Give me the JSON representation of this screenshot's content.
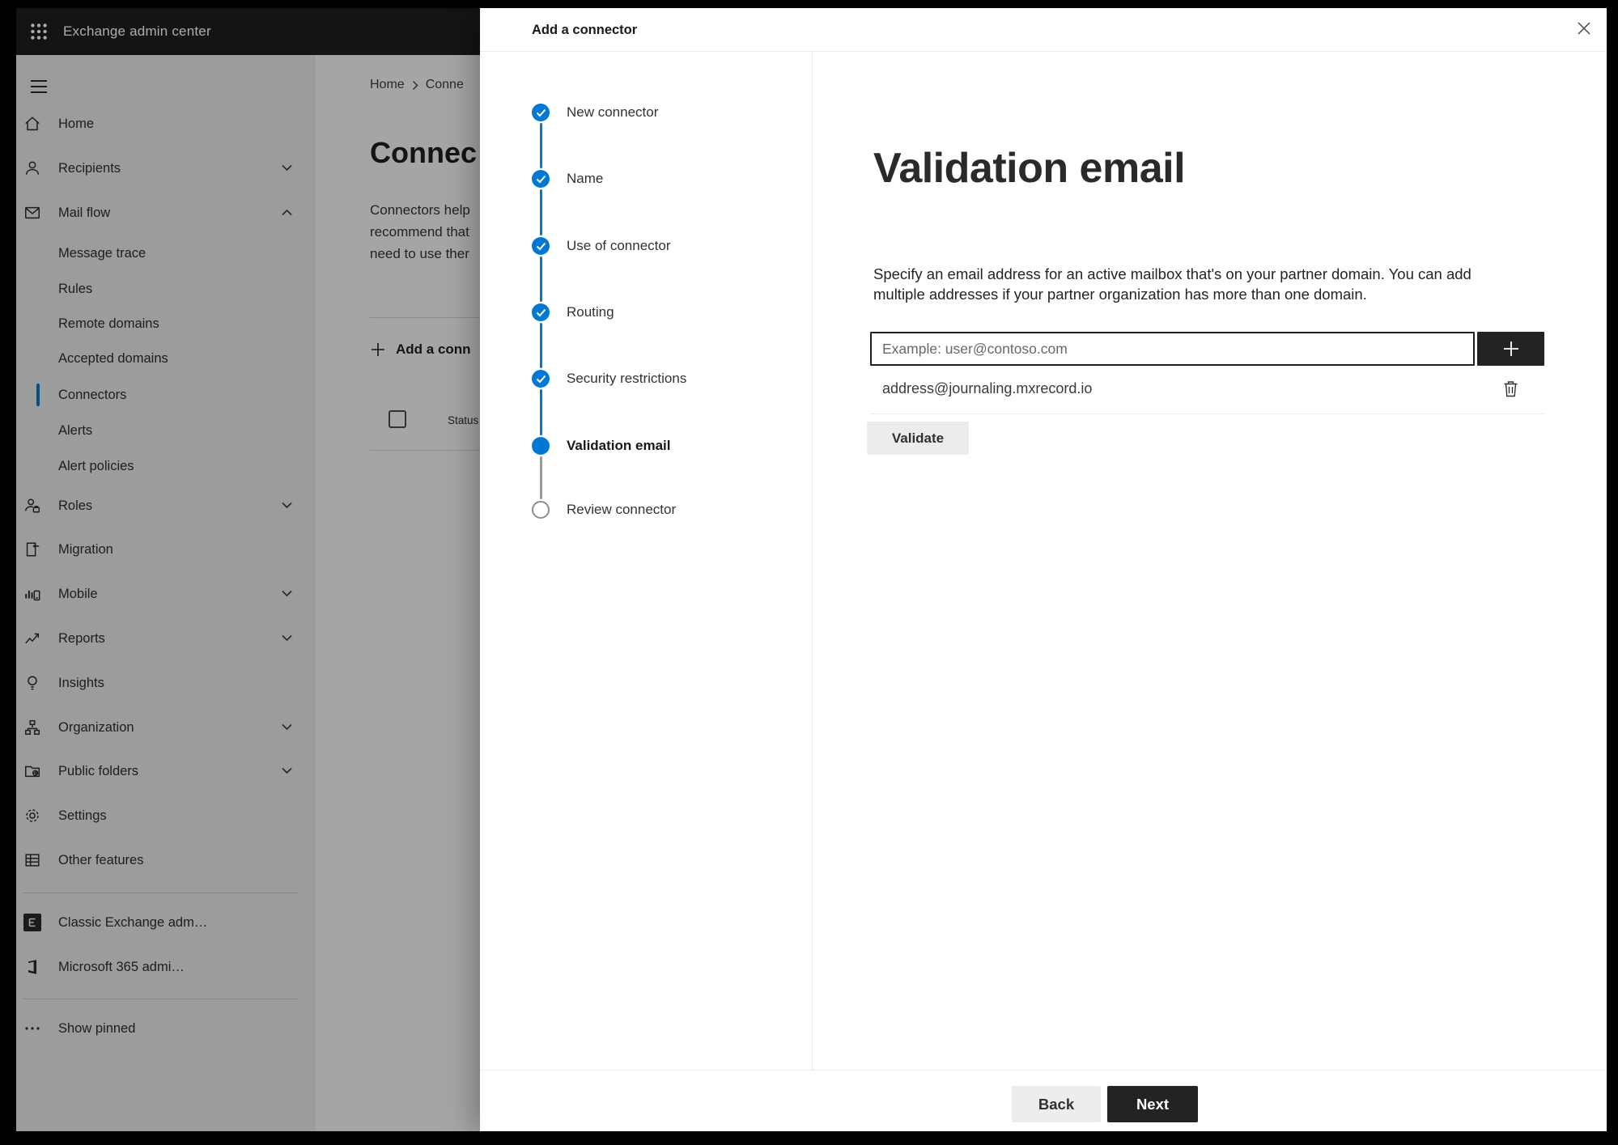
{
  "topbar": {
    "title": "Exchange admin center"
  },
  "sidebar": {
    "items": [
      {
        "label": "Home"
      },
      {
        "label": "Recipients"
      },
      {
        "label": "Mail flow"
      },
      {
        "label": "Message trace"
      },
      {
        "label": "Rules"
      },
      {
        "label": "Remote domains"
      },
      {
        "label": "Accepted domains"
      },
      {
        "label": "Connectors"
      },
      {
        "label": "Alerts"
      },
      {
        "label": "Alert policies"
      },
      {
        "label": "Roles"
      },
      {
        "label": "Migration"
      },
      {
        "label": "Mobile"
      },
      {
        "label": "Reports"
      },
      {
        "label": "Insights"
      },
      {
        "label": "Organization"
      },
      {
        "label": "Public folders"
      },
      {
        "label": "Settings"
      },
      {
        "label": "Other features"
      }
    ],
    "classic_admin": "Classic Exchange adm…",
    "m365_admin": "Microsoft 365 admi…",
    "show_pinned": "Show pinned"
  },
  "page": {
    "breadcrumb_home": "Home",
    "breadcrumb_current": "Conne",
    "title": "Connec",
    "desc_lines": [
      "Connectors help",
      "recommend that",
      "need to use ther"
    ],
    "add_button": "Add a conn",
    "status_header": "Status"
  },
  "wizard": {
    "title": "Add a connector",
    "steps": [
      {
        "label": "New connector",
        "state": "done"
      },
      {
        "label": "Name",
        "state": "done"
      },
      {
        "label": "Use of connector",
        "state": "done"
      },
      {
        "label": "Routing",
        "state": "done"
      },
      {
        "label": "Security restrictions",
        "state": "done"
      },
      {
        "label": "Validation email",
        "state": "current"
      },
      {
        "label": "Review connector",
        "state": "todo"
      }
    ],
    "heading": "Validation email",
    "description_lines": [
      "Specify an email address for an active mailbox that's on your partner domain. You can add",
      "multiple addresses if your partner organization has more than one domain."
    ],
    "email_placeholder": "Example: user@contoso.com",
    "email_value": "",
    "addresses": [
      {
        "email": "address@journaling.mxrecord.io"
      }
    ],
    "validate_button": "Validate",
    "back_button": "Back",
    "next_button": "Next"
  },
  "colors": {
    "accent": "#0078d4",
    "primary_button": "#242322",
    "topbar_bg": "#1f1f1f"
  }
}
